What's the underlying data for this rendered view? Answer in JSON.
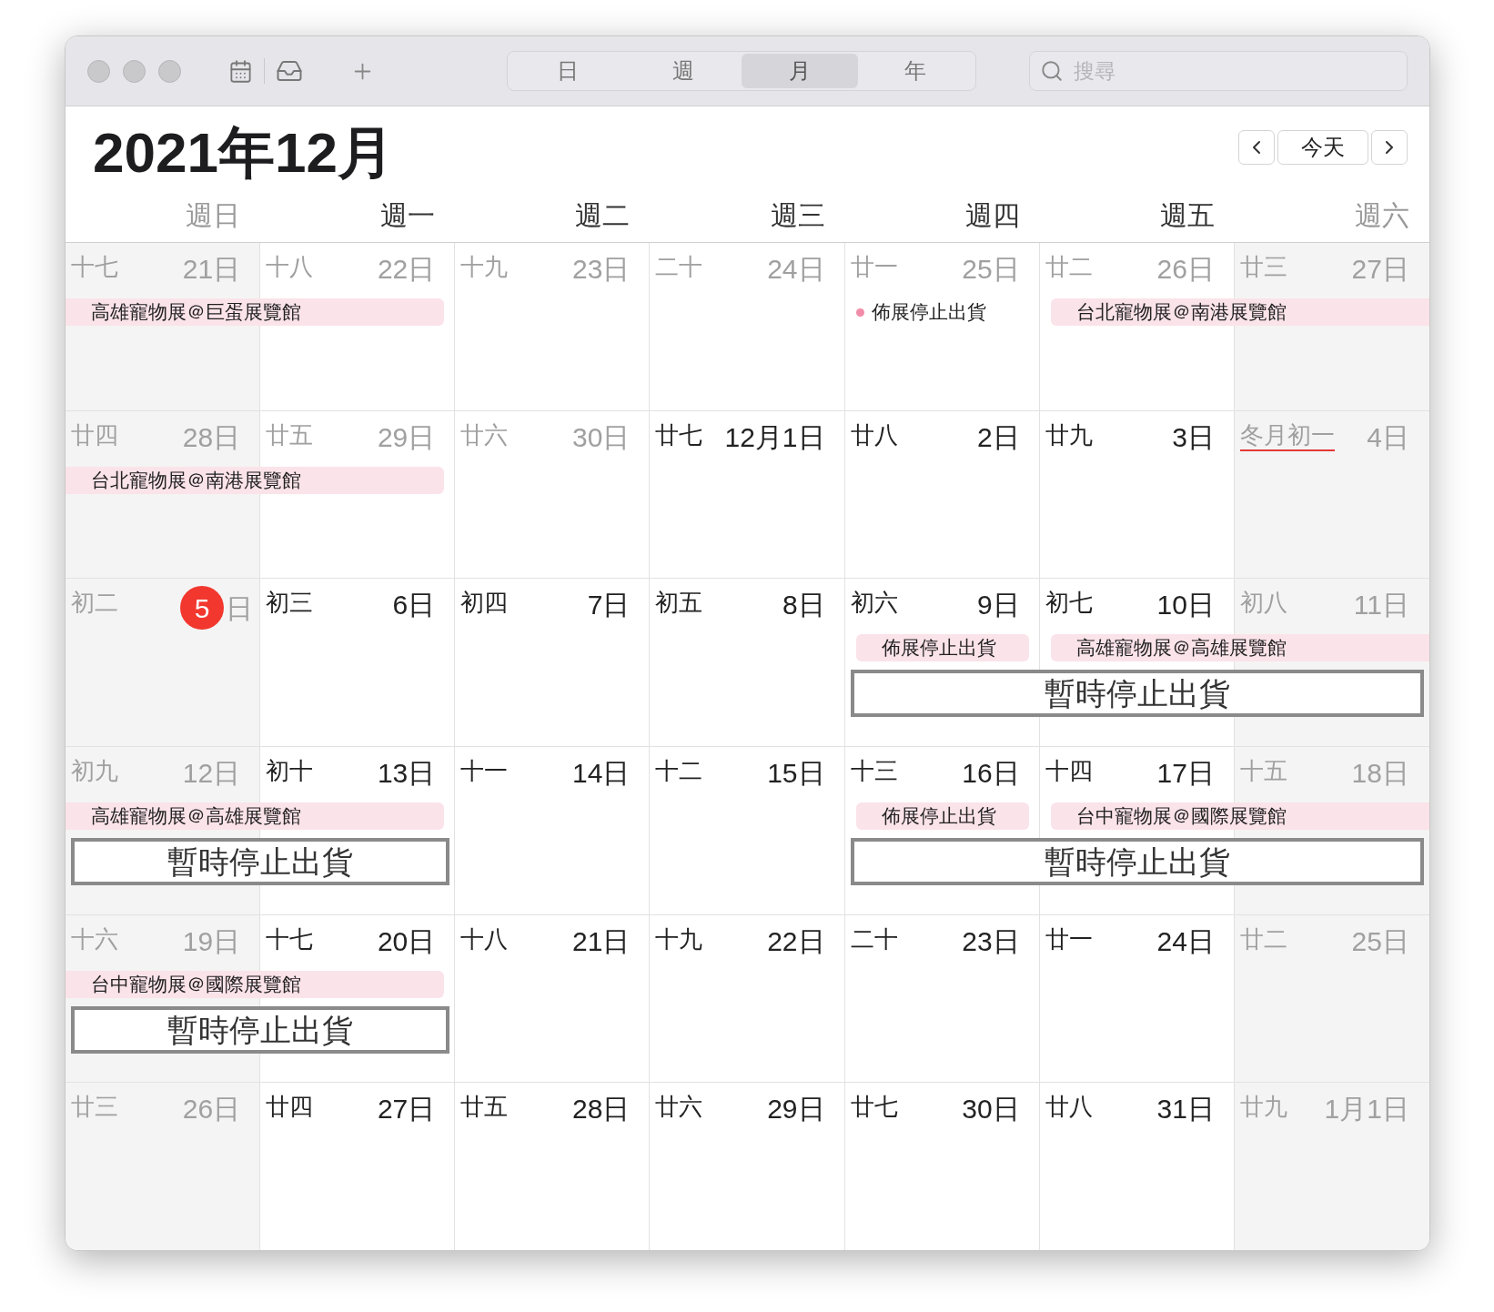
{
  "toolbar": {
    "views": [
      {
        "label": "日",
        "selected": false
      },
      {
        "label": "週",
        "selected": false
      },
      {
        "label": "月",
        "selected": true
      },
      {
        "label": "年",
        "selected": false
      }
    ],
    "search": {
      "placeholder": "搜尋"
    }
  },
  "header": {
    "title": "2021年12月",
    "today_button": "今天"
  },
  "weekdays": [
    {
      "label": "週日",
      "dimmed": true
    },
    {
      "label": "週一",
      "dimmed": false
    },
    {
      "label": "週二",
      "dimmed": false
    },
    {
      "label": "週三",
      "dimmed": false
    },
    {
      "label": "週四",
      "dimmed": false
    },
    {
      "label": "週五",
      "dimmed": false
    },
    {
      "label": "週六",
      "dimmed": true
    }
  ],
  "weeks": [
    {
      "days": [
        {
          "lunar": "十七",
          "day": "21日",
          "dimmed": true,
          "today": false,
          "marked": false,
          "events": [
            {
              "title": "高雄寵物展＠巨蛋展覽館",
              "kind": "bar",
              "multi_day": true
            }
          ]
        },
        {
          "lunar": "十八",
          "day": "22日",
          "dimmed": true,
          "today": false,
          "marked": false
        },
        {
          "lunar": "十九",
          "day": "23日",
          "dimmed": true,
          "today": false,
          "marked": false
        },
        {
          "lunar": "二十",
          "day": "24日",
          "dimmed": true,
          "today": false,
          "marked": false
        },
        {
          "lunar": "廿一",
          "day": "25日",
          "dimmed": true,
          "today": false,
          "marked": false,
          "events": [
            {
              "title": "佈展停止出貨",
              "kind": "dot"
            }
          ]
        },
        {
          "lunar": "廿二",
          "day": "26日",
          "dimmed": true,
          "today": false,
          "marked": false,
          "events": [
            {
              "title": "台北寵物展＠南港展覽館",
              "kind": "bar",
              "multi_day": true
            }
          ]
        },
        {
          "lunar": "廿三",
          "day": "27日",
          "dimmed": true,
          "today": false,
          "marked": false
        }
      ]
    },
    {
      "days": [
        {
          "lunar": "廿四",
          "day": "28日",
          "dimmed": true,
          "today": false,
          "marked": false,
          "events": [
            {
              "title": "台北寵物展＠南港展覽館",
              "kind": "bar",
              "multi_day": true
            }
          ]
        },
        {
          "lunar": "廿五",
          "day": "29日",
          "dimmed": true,
          "today": false,
          "marked": false
        },
        {
          "lunar": "廿六",
          "day": "30日",
          "dimmed": true,
          "today": false,
          "marked": false
        },
        {
          "lunar": "廿七",
          "day": "12月1日",
          "dimmed": false,
          "today": false,
          "marked": false
        },
        {
          "lunar": "廿八",
          "day": "2日",
          "dimmed": false,
          "today": false,
          "marked": false
        },
        {
          "lunar": "廿九",
          "day": "3日",
          "dimmed": false,
          "today": false,
          "marked": false
        },
        {
          "lunar": "冬月初一",
          "day": "4日",
          "dimmed": true,
          "today": false,
          "marked": true
        }
      ]
    },
    {
      "days": [
        {
          "lunar": "初二",
          "day": "5",
          "unit": "日",
          "dimmed": true,
          "today": true,
          "marked": false
        },
        {
          "lunar": "初三",
          "day": "6日",
          "dimmed": false,
          "today": false,
          "marked": false
        },
        {
          "lunar": "初四",
          "day": "7日",
          "dimmed": false,
          "today": false,
          "marked": false
        },
        {
          "lunar": "初五",
          "day": "8日",
          "dimmed": false,
          "today": false,
          "marked": false
        },
        {
          "lunar": "初六",
          "day": "9日",
          "dimmed": false,
          "today": false,
          "marked": false,
          "events": [
            {
              "title": "佈展停止出貨",
              "kind": "bar",
              "multi_day": false
            },
            {
              "title": "暫時停止出貨",
              "kind": "box",
              "multi_day": true
            }
          ]
        },
        {
          "lunar": "初七",
          "day": "10日",
          "dimmed": false,
          "today": false,
          "marked": false,
          "events": [
            {
              "title": "高雄寵物展＠高雄展覽館",
              "kind": "bar",
              "multi_day": true
            }
          ]
        },
        {
          "lunar": "初八",
          "day": "11日",
          "dimmed": true,
          "today": false,
          "marked": false
        }
      ]
    },
    {
      "days": [
        {
          "lunar": "初九",
          "day": "12日",
          "dimmed": true,
          "today": false,
          "marked": false,
          "events": [
            {
              "title": "高雄寵物展＠高雄展覽館",
              "kind": "bar",
              "multi_day": true
            },
            {
              "title": "暫時停止出貨",
              "kind": "box",
              "multi_day": true
            }
          ]
        },
        {
          "lunar": "初十",
          "day": "13日",
          "dimmed": false,
          "today": false,
          "marked": false
        },
        {
          "lunar": "十一",
          "day": "14日",
          "dimmed": false,
          "today": false,
          "marked": false
        },
        {
          "lunar": "十二",
          "day": "15日",
          "dimmed": false,
          "today": false,
          "marked": false
        },
        {
          "lunar": "十三",
          "day": "16日",
          "dimmed": false,
          "today": false,
          "marked": false,
          "events": [
            {
              "title": "佈展停止出貨",
              "kind": "bar",
              "multi_day": false
            },
            {
              "title": "暫時停止出貨",
              "kind": "box",
              "multi_day": true
            }
          ]
        },
        {
          "lunar": "十四",
          "day": "17日",
          "dimmed": false,
          "today": false,
          "marked": false,
          "events": [
            {
              "title": "台中寵物展＠國際展覽館",
              "kind": "bar",
              "multi_day": true
            }
          ]
        },
        {
          "lunar": "十五",
          "day": "18日",
          "dimmed": true,
          "today": false,
          "marked": false
        }
      ]
    },
    {
      "days": [
        {
          "lunar": "十六",
          "day": "19日",
          "dimmed": true,
          "today": false,
          "marked": false,
          "events": [
            {
              "title": "台中寵物展＠國際展覽館",
              "kind": "bar",
              "multi_day": true
            },
            {
              "title": "暫時停止出貨",
              "kind": "box",
              "multi_day": true
            }
          ]
        },
        {
          "lunar": "十七",
          "day": "20日",
          "dimmed": false,
          "today": false,
          "marked": false
        },
        {
          "lunar": "十八",
          "day": "21日",
          "dimmed": false,
          "today": false,
          "marked": false
        },
        {
          "lunar": "十九",
          "day": "22日",
          "dimmed": false,
          "today": false,
          "marked": false
        },
        {
          "lunar": "二十",
          "day": "23日",
          "dimmed": false,
          "today": false,
          "marked": false
        },
        {
          "lunar": "廿一",
          "day": "24日",
          "dimmed": false,
          "today": false,
          "marked": false
        },
        {
          "lunar": "廿二",
          "day": "25日",
          "dimmed": true,
          "today": false,
          "marked": false
        }
      ]
    },
    {
      "days": [
        {
          "lunar": "廿三",
          "day": "26日",
          "dimmed": true,
          "today": false,
          "marked": false
        },
        {
          "lunar": "廿四",
          "day": "27日",
          "dimmed": false,
          "today": false,
          "marked": false
        },
        {
          "lunar": "廿五",
          "day": "28日",
          "dimmed": false,
          "today": false,
          "marked": false
        },
        {
          "lunar": "廿六",
          "day": "29日",
          "dimmed": false,
          "today": false,
          "marked": false
        },
        {
          "lunar": "廿七",
          "day": "30日",
          "dimmed": false,
          "today": false,
          "marked": false
        },
        {
          "lunar": "廿八",
          "day": "31日",
          "dimmed": false,
          "today": false,
          "marked": false
        },
        {
          "lunar": "廿九",
          "day": "1月1日",
          "dimmed": true,
          "today": false,
          "marked": false
        }
      ]
    }
  ]
}
